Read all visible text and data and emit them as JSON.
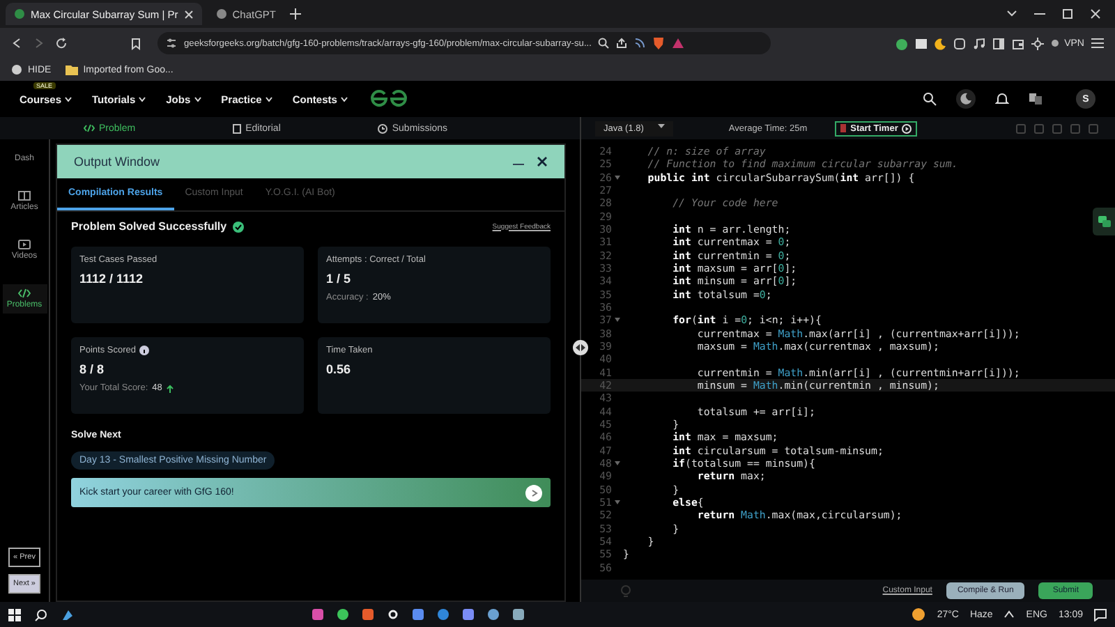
{
  "browser": {
    "tabs": [
      {
        "title": "Max Circular Subarray Sum | Pr",
        "selected": true
      },
      {
        "title": "ChatGPT",
        "selected": false
      }
    ],
    "url": "geeksforgeeks.org/batch/gfg-160-problems/track/arrays-gfg-160/problem/max-circular-subarray-su...",
    "bookmarks": [
      "HIDE",
      "Imported from Goo..."
    ],
    "vpn": "VPN"
  },
  "site_nav": {
    "badge": "SALE",
    "menus": [
      "Courses",
      "Tutorials",
      "Jobs",
      "Practice",
      "Contests"
    ],
    "avatar": "S"
  },
  "problem_tabs": [
    {
      "label": "Problem",
      "selected": true
    },
    {
      "label": "Editorial",
      "selected": false
    },
    {
      "label": "Submissions",
      "selected": false
    }
  ],
  "sidebar": {
    "items": [
      {
        "label": "Dash",
        "selected": false
      },
      {
        "label": "Articles",
        "selected": false
      },
      {
        "label": "Videos",
        "selected": false
      },
      {
        "label": "Problems",
        "selected": true
      }
    ],
    "prev": "« Prev",
    "next": "Next »"
  },
  "output_window": {
    "title": "Output Window",
    "tabs": [
      {
        "label": "Compilation Results",
        "selected": true
      },
      {
        "label": "Custom Input",
        "selected": false
      },
      {
        "label": "Y.O.G.I. (AI Bot)",
        "selected": false
      }
    ],
    "status": "Problem Solved Successfully",
    "feedback": "Suggest Feedback",
    "cards": [
      {
        "kind": "plain",
        "label": "Test Cases Passed",
        "value": "1112 / 1112"
      },
      {
        "kind": "accuracy",
        "label": "Attempts : Correct / Total",
        "value": "1 / 5",
        "note": "Accuracy :",
        "note_value": "20%"
      },
      {
        "kind": "score",
        "label": "Points Scored",
        "value": "8 / 8",
        "note": "Your Total Score:",
        "note_value": "48"
      },
      {
        "kind": "plain",
        "label": "Time Taken",
        "value": "0.56"
      }
    ],
    "solve_next": {
      "heading": "Solve Next",
      "problem": "Day 13 - Smallest Positive Missing Number"
    },
    "banner": "Kick start your career with GfG 160!"
  },
  "editor": {
    "language": "Java (1.8)",
    "average_time": "Average Time: 25m",
    "timer": "Start Timer",
    "lines": [
      {
        "number": "24",
        "foldable": false,
        "active": false,
        "segments": [
          {
            "kind": "comment",
            "text": "    // n: size of array"
          }
        ]
      },
      {
        "number": "25",
        "foldable": false,
        "active": false,
        "segments": [
          {
            "kind": "comment",
            "text": "    // Function to find maximum circular subarray sum."
          }
        ]
      },
      {
        "number": "26",
        "foldable": true,
        "active": false,
        "segments": [
          {
            "kind": "keyword",
            "text": "    public int"
          },
          {
            "kind": "plain",
            "text": " circularSubarraySum("
          },
          {
            "kind": "keyword",
            "text": "int"
          },
          {
            "kind": "plain",
            "text": " arr[]) {"
          }
        ]
      },
      {
        "number": "27",
        "foldable": false,
        "active": false
      },
      {
        "number": "28",
        "foldable": false,
        "active": false,
        "segments": [
          {
            "kind": "comment",
            "text": "        // Your code here"
          }
        ]
      },
      {
        "number": "29",
        "foldable": false,
        "active": false
      },
      {
        "number": "30",
        "foldable": false,
        "active": false,
        "segments": [
          {
            "kind": "keyword",
            "text": "        int"
          },
          {
            "kind": "plain",
            "text": " n = arr.length;"
          }
        ]
      },
      {
        "number": "31",
        "foldable": false,
        "active": false,
        "segments": [
          {
            "kind": "keyword",
            "text": "        int"
          },
          {
            "kind": "plain",
            "text": " currentmax = "
          },
          {
            "kind": "number",
            "text": "0"
          },
          {
            "kind": "plain",
            "text": ";"
          }
        ]
      },
      {
        "number": "32",
        "foldable": false,
        "active": false,
        "segments": [
          {
            "kind": "keyword",
            "text": "        int"
          },
          {
            "kind": "plain",
            "text": " currentmin = "
          },
          {
            "kind": "number",
            "text": "0"
          },
          {
            "kind": "plain",
            "text": ";"
          }
        ]
      },
      {
        "number": "33",
        "foldable": false,
        "active": false,
        "segments": [
          {
            "kind": "keyword",
            "text": "        int"
          },
          {
            "kind": "plain",
            "text": " maxsum = arr["
          },
          {
            "kind": "number",
            "text": "0"
          },
          {
            "kind": "plain",
            "text": "];"
          }
        ]
      },
      {
        "number": "34",
        "foldable": false,
        "active": false,
        "segments": [
          {
            "kind": "keyword",
            "text": "        int"
          },
          {
            "kind": "plain",
            "text": " minsum = arr["
          },
          {
            "kind": "number",
            "text": "0"
          },
          {
            "kind": "plain",
            "text": "];"
          }
        ]
      },
      {
        "number": "35",
        "foldable": false,
        "active": false,
        "segments": [
          {
            "kind": "keyword",
            "text": "        int"
          },
          {
            "kind": "plain",
            "text": " totalsum ="
          },
          {
            "kind": "number",
            "text": "0"
          },
          {
            "kind": "plain",
            "text": ";"
          }
        ]
      },
      {
        "number": "36",
        "foldable": false,
        "active": false
      },
      {
        "number": "37",
        "foldable": true,
        "active": false,
        "segments": [
          {
            "kind": "keyword",
            "text": "        for"
          },
          {
            "kind": "plain",
            "text": "("
          },
          {
            "kind": "keyword",
            "text": "int"
          },
          {
            "kind": "plain",
            "text": " i ="
          },
          {
            "kind": "number",
            "text": "0"
          },
          {
            "kind": "plain",
            "text": "; i<n; i++){"
          }
        ]
      },
      {
        "number": "38",
        "foldable": false,
        "active": false,
        "segments": [
          {
            "kind": "plain",
            "text": "            currentmax = "
          },
          {
            "kind": "class",
            "text": "Math"
          },
          {
            "kind": "plain",
            "text": ".max(arr[i] , (currentmax+arr[i]));"
          }
        ]
      },
      {
        "number": "39",
        "foldable": false,
        "active": false,
        "segments": [
          {
            "kind": "plain",
            "text": "            maxsum = "
          },
          {
            "kind": "class",
            "text": "Math"
          },
          {
            "kind": "plain",
            "text": ".max(currentmax , maxsum);"
          }
        ]
      },
      {
        "number": "40",
        "foldable": false,
        "active": false
      },
      {
        "number": "41",
        "foldable": false,
        "active": false,
        "segments": [
          {
            "kind": "plain",
            "text": "            currentmin = "
          },
          {
            "kind": "class",
            "text": "Math"
          },
          {
            "kind": "plain",
            "text": ".min(arr[i] , (currentmin+arr[i]));"
          }
        ]
      },
      {
        "number": "42",
        "foldable": false,
        "active": true,
        "segments": [
          {
            "kind": "plain",
            "text": "            minsum = "
          },
          {
            "kind": "class",
            "text": "Math"
          },
          {
            "kind": "plain",
            "text": ".min(currentmin , minsum);"
          }
        ]
      },
      {
        "number": "43",
        "foldable": false,
        "active": false
      },
      {
        "number": "44",
        "foldable": false,
        "active": false,
        "segments": [
          {
            "kind": "plain",
            "text": "            totalsum += arr[i];"
          }
        ]
      },
      {
        "number": "45",
        "foldable": false,
        "active": false,
        "segments": [
          {
            "kind": "plain",
            "text": "        }"
          }
        ]
      },
      {
        "number": "46",
        "foldable": false,
        "active": false,
        "segments": [
          {
            "kind": "keyword",
            "text": "        int"
          },
          {
            "kind": "plain",
            "text": " max = maxsum;"
          }
        ]
      },
      {
        "number": "47",
        "foldable": false,
        "active": false,
        "segments": [
          {
            "kind": "keyword",
            "text": "        int"
          },
          {
            "kind": "plain",
            "text": " circularsum = totalsum-minsum;"
          }
        ]
      },
      {
        "number": "48",
        "foldable": true,
        "active": false,
        "segments": [
          {
            "kind": "keyword",
            "text": "        if"
          },
          {
            "kind": "plain",
            "text": "(totalsum == minsum){"
          }
        ]
      },
      {
        "number": "49",
        "foldable": false,
        "active": false,
        "segments": [
          {
            "kind": "keyword",
            "text": "            return"
          },
          {
            "kind": "plain",
            "text": " max;"
          }
        ]
      },
      {
        "number": "50",
        "foldable": false,
        "active": false,
        "segments": [
          {
            "kind": "plain",
            "text": "        }"
          }
        ]
      },
      {
        "number": "51",
        "foldable": true,
        "active": false,
        "segments": [
          {
            "kind": "keyword",
            "text": "        else"
          },
          {
            "kind": "plain",
            "text": "{"
          }
        ]
      },
      {
        "number": "52",
        "foldable": false,
        "active": false,
        "segments": [
          {
            "kind": "keyword",
            "text": "            return "
          },
          {
            "kind": "class",
            "text": "Math"
          },
          {
            "kind": "plain",
            "text": ".max(max,circularsum);"
          }
        ]
      },
      {
        "number": "53",
        "foldable": false,
        "active": false,
        "segments": [
          {
            "kind": "plain",
            "text": "        }"
          }
        ]
      },
      {
        "number": "54",
        "foldable": false,
        "active": false,
        "segments": [
          {
            "kind": "plain",
            "text": "    }"
          }
        ]
      },
      {
        "number": "55",
        "foldable": false,
        "active": false,
        "segments": [
          {
            "kind": "plain",
            "text": "}"
          }
        ]
      },
      {
        "number": "56",
        "foldable": false,
        "active": false
      }
    ],
    "custom_input": "Custom Input",
    "compile": "Compile & Run",
    "submit": "Submit"
  },
  "taskbar": {
    "temperature": "27°C",
    "condition": "Haze",
    "language": "ENG",
    "time": "13:09"
  }
}
